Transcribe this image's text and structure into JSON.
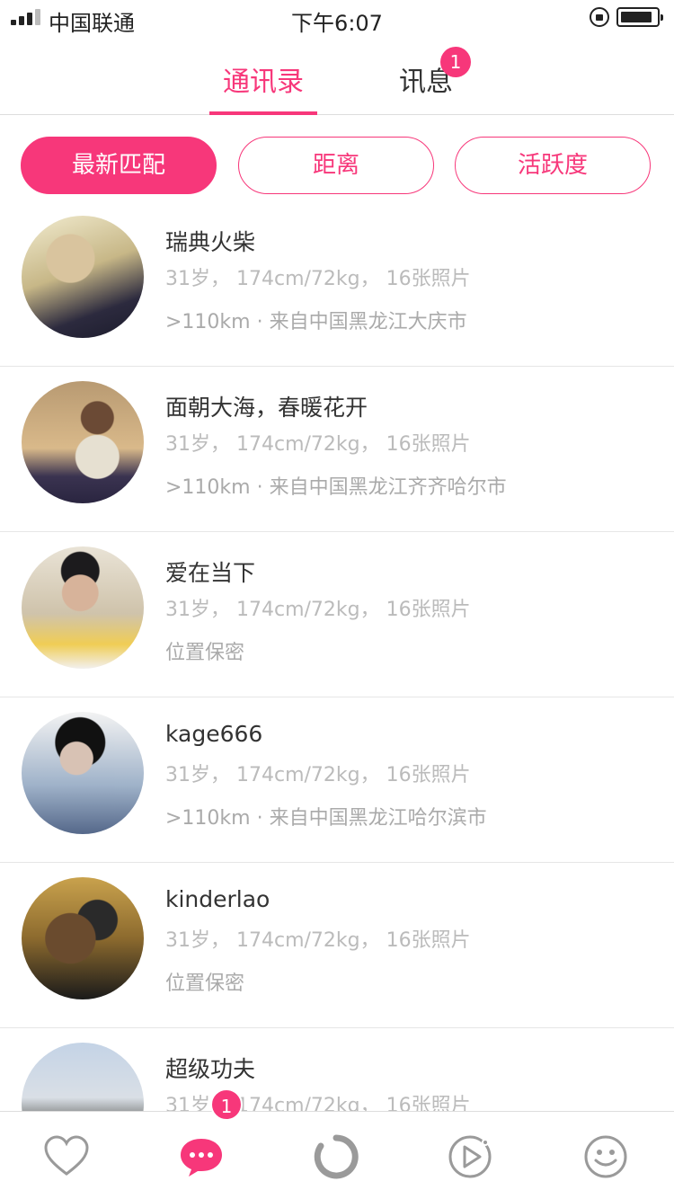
{
  "status_bar": {
    "carrier": "中国联通",
    "time": "下午6:07"
  },
  "top_tabs": {
    "contacts": "通讯录",
    "messages": "讯息",
    "messages_badge": "1"
  },
  "filters": {
    "newest": "最新匹配",
    "distance": "距离",
    "activity": "活跃度"
  },
  "users": [
    {
      "name": "瑞典火柴",
      "meta": "31岁， 174cm/72kg， 16张照片",
      "location": ">110km · 来自中国黑龙江大庆市"
    },
    {
      "name": "面朝大海，春暖花开",
      "meta": "31岁， 174cm/72kg， 16张照片",
      "location": ">110km · 来自中国黑龙江齐齐哈尔市"
    },
    {
      "name": "爱在当下",
      "meta": "31岁， 174cm/72kg， 16张照片",
      "location": "位置保密"
    },
    {
      "name": "kage666",
      "meta": "31岁， 174cm/72kg， 16张照片",
      "location": ">110km · 来自中国黑龙江哈尔滨市"
    },
    {
      "name": "kinderlao",
      "meta": "31岁， 174cm/72kg， 16张照片",
      "location": "位置保密"
    },
    {
      "name": "超级功夫",
      "meta": "31岁， 174cm/72kg， 16张照片",
      "location": ""
    }
  ],
  "bottom_nav": {
    "chat_badge": "1",
    "icons": [
      "heart-icon",
      "chat-bubble-icon",
      "refresh-icon",
      "play-icon",
      "smile-icon"
    ]
  },
  "colors": {
    "accent": "#f7377a"
  }
}
